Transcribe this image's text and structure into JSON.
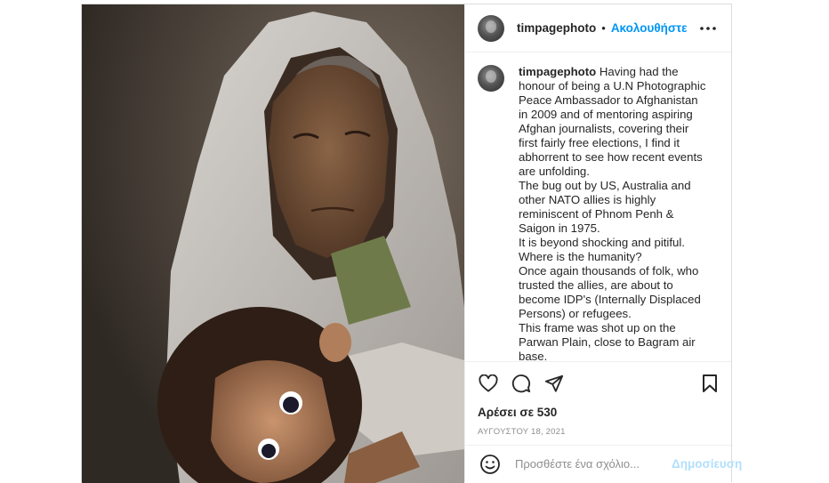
{
  "header": {
    "username": "timpagephoto",
    "separator": "•",
    "follow_label": "Ακολουθήστε"
  },
  "caption": {
    "username": "timpagephoto",
    "text": " Having had the honour of being a U.N Photographic Peace Ambassador to Afghanistan in 2009 and of mentoring aspiring Afghan journalists, covering their first fairly free elections, I find it abhorrent to see how recent events are unfolding.\nThe bug out by US, Australia and other NATO allies is highly reminiscent of Phnom Penh & Saigon in 1975.\nIt is beyond shocking and pitiful.\nWhere is the humanity?\nOnce again thousands of folk, who trusted the allies, are about to become IDP's (Internally Displaced Persons) or refugees.\nThis frame was shot up on the Parwan Plain, close to Bagram air base.\nThis family was being re-housed in a shelled compound, funded by"
  },
  "engagement": {
    "likes_label": "Αρέσει σε 530",
    "date_label": "ΑΥΓΟΥΣΤΟΥ 18, 2021"
  },
  "comment": {
    "placeholder": "Προσθέστε ένα σχόλιο...",
    "post_label": "Δημοσίευση"
  },
  "icons": {
    "more": "more-options-icon",
    "like": "heart-icon",
    "comment": "comment-icon",
    "share": "share-icon",
    "save": "bookmark-icon",
    "emoji": "emoji-icon"
  },
  "colors": {
    "accent": "#0095f6",
    "post_disabled": "#b2dffc",
    "text": "#262626",
    "muted": "#8e8e8e",
    "border": "#dbdbdb"
  }
}
